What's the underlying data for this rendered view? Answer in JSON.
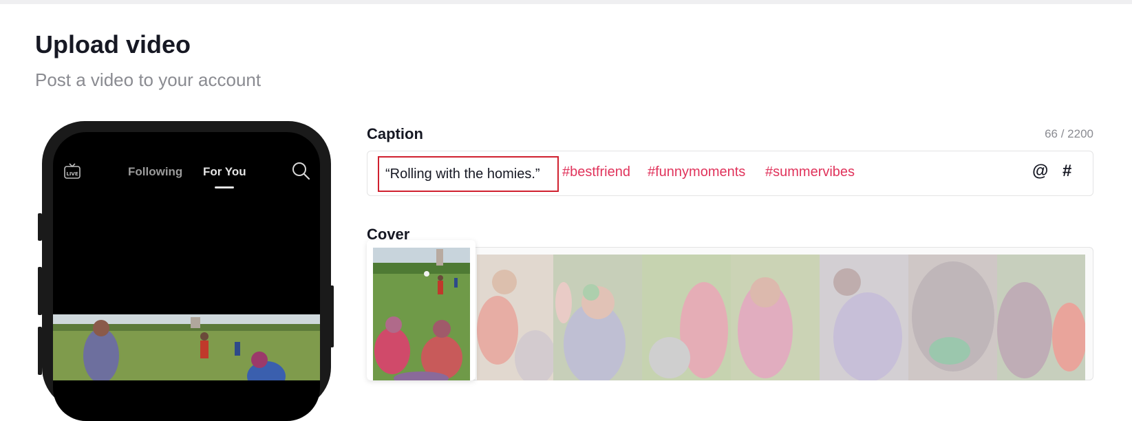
{
  "header": {
    "title": "Upload video",
    "subtitle": "Post a video to your account"
  },
  "preview": {
    "tabs": [
      "Following",
      "For You"
    ],
    "active_tab": "For You",
    "icons": {
      "left": "live-icon",
      "right": "search-icon"
    }
  },
  "caption": {
    "label": "Caption",
    "count": "66 / 2200",
    "text": "“Rolling with the homies.”",
    "hashtags": [
      "#bestfriend",
      "#funnymoments",
      "#summervibes"
    ],
    "mention_symbol": "@",
    "hashtag_symbol": "#",
    "highlight_color": "#d0202e",
    "hashtag_color": "#e0335b"
  },
  "cover": {
    "label": "Cover"
  }
}
